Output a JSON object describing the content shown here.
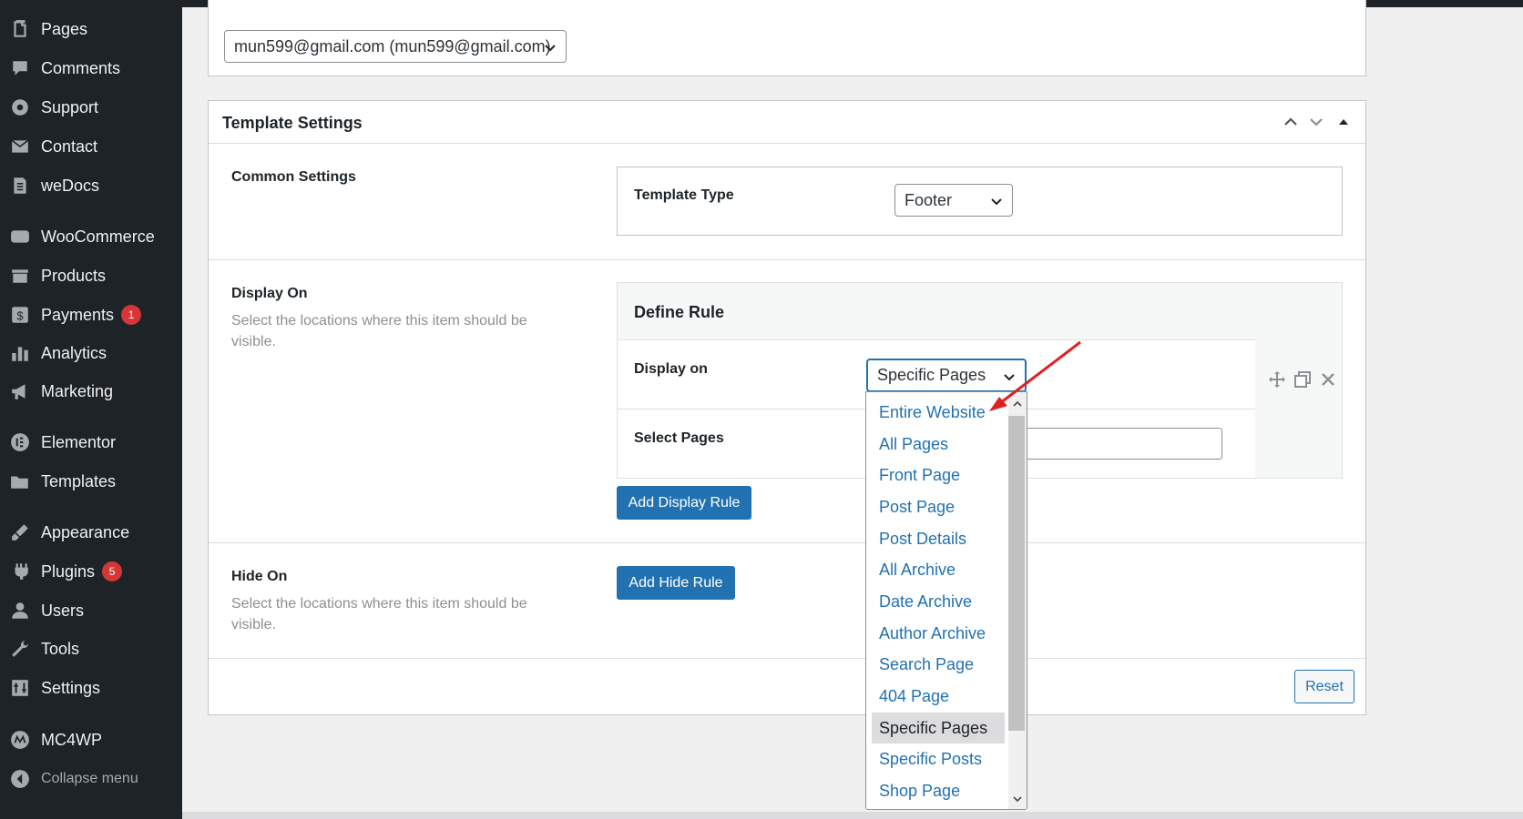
{
  "sidebar": {
    "items": [
      {
        "label": "Pages",
        "icon": "pages-icon"
      },
      {
        "label": "Comments",
        "icon": "comments-icon"
      },
      {
        "label": "Support",
        "icon": "support-icon"
      },
      {
        "label": "Contact",
        "icon": "contact-icon"
      },
      {
        "label": "weDocs",
        "icon": "wedocs-icon"
      },
      {
        "label": "WooCommerce",
        "icon": "woocommerce-icon"
      },
      {
        "label": "Products",
        "icon": "products-icon"
      },
      {
        "label": "Payments",
        "icon": "payments-icon",
        "badge": "1"
      },
      {
        "label": "Analytics",
        "icon": "analytics-icon"
      },
      {
        "label": "Marketing",
        "icon": "marketing-icon"
      },
      {
        "label": "Elementor",
        "icon": "elementor-icon"
      },
      {
        "label": "Templates",
        "icon": "templates-icon"
      },
      {
        "label": "Appearance",
        "icon": "appearance-icon"
      },
      {
        "label": "Plugins",
        "icon": "plugins-icon",
        "badge": "5"
      },
      {
        "label": "Users",
        "icon": "users-icon"
      },
      {
        "label": "Tools",
        "icon": "tools-icon"
      },
      {
        "label": "Settings",
        "icon": "settings-icon"
      },
      {
        "label": "MC4WP",
        "icon": "mc4wp-icon"
      }
    ],
    "collapse_label": "Collapse menu"
  },
  "author_box": {
    "selected": "mun599@gmail.com (mun599@gmail.com)"
  },
  "template_settings": {
    "title": "Template Settings",
    "common": {
      "heading": "Common Settings",
      "template_type_label": "Template Type",
      "template_type_value": "Footer"
    },
    "display_on": {
      "heading": "Display On",
      "description": "Select the locations where this item should be visible.",
      "define_rule": "Define Rule",
      "display_on_label": "Display on",
      "display_on_value": "Specific Pages",
      "select_pages_label": "Select Pages",
      "add_rule_button": "Add Display Rule"
    },
    "hide_on": {
      "heading": "Hide On",
      "description": "Select the locations where this item should be visible.",
      "add_rule_button": "Add Hide Rule"
    },
    "reset_button": "Reset"
  },
  "dropdown": {
    "options": [
      "Entire Website",
      "All Pages",
      "Front Page",
      "Post Page",
      "Post Details",
      "All Archive",
      "Date Archive",
      "Author Archive",
      "Search Page",
      "404 Page",
      "Specific Pages",
      "Specific Posts",
      "Shop Page"
    ],
    "selected": "Specific Pages"
  },
  "colors": {
    "sidebar_bg": "#1d2327",
    "accent": "#2271b1",
    "badge": "#d63638",
    "annotation_arrow": "#e02020"
  }
}
